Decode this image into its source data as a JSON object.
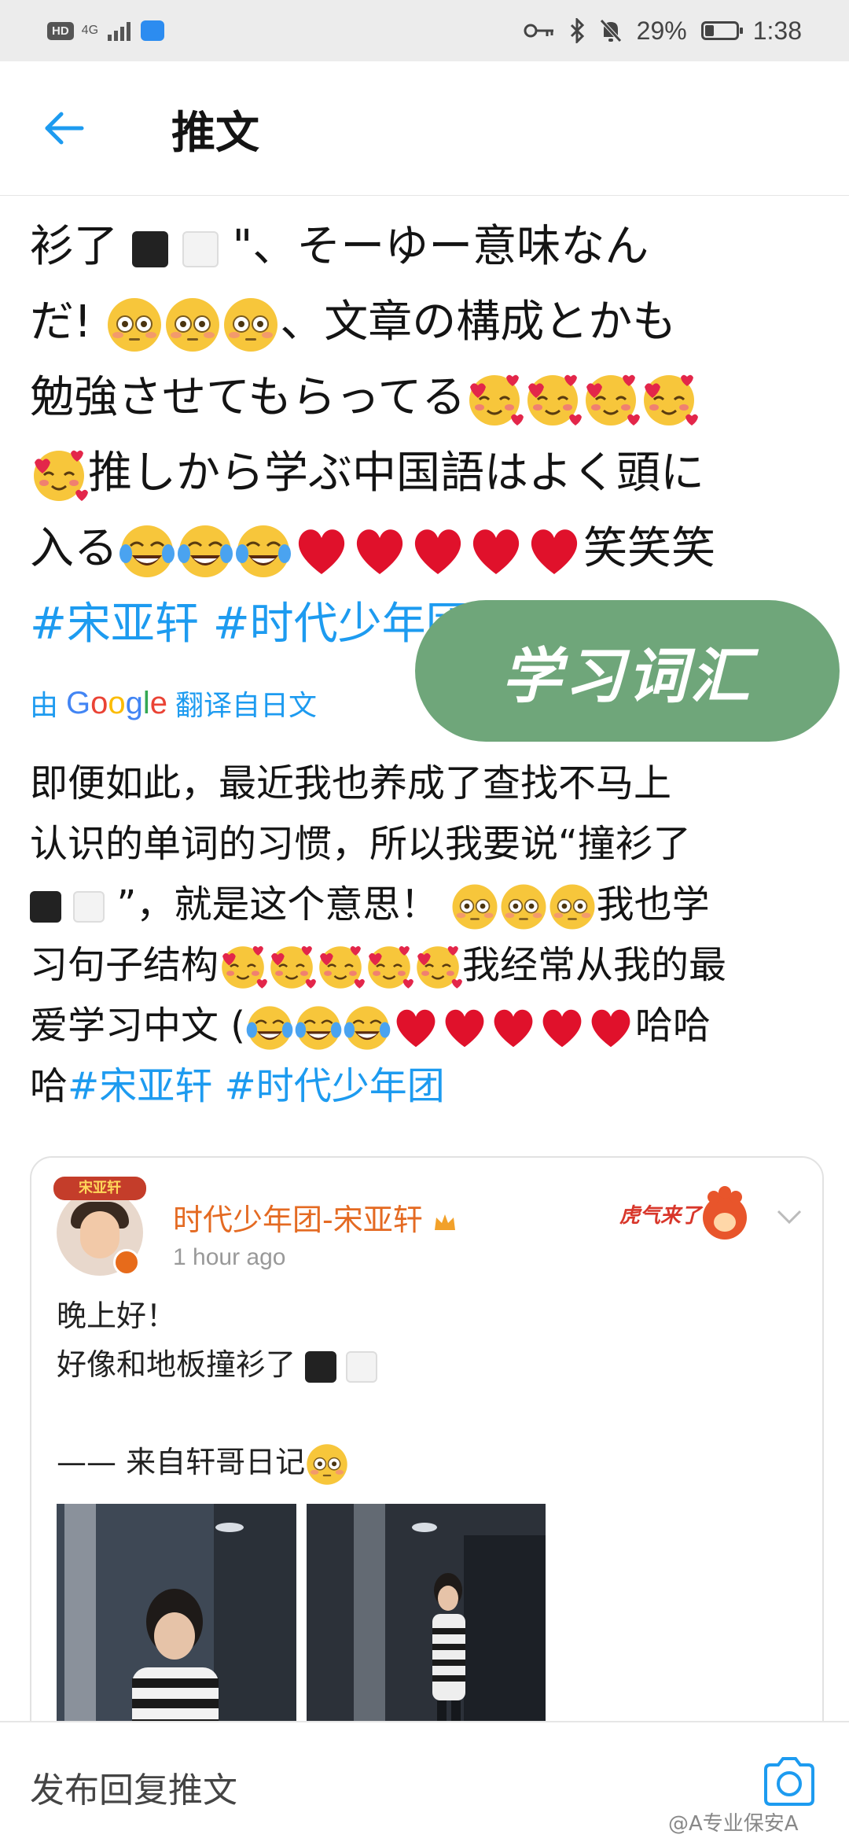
{
  "status_bar": {
    "hd": "HD",
    "network": "4G",
    "battery_percent": "29%",
    "battery_level": 0.29,
    "time": "1:38",
    "icons": [
      "key-icon",
      "bluetooth-icon",
      "mute-bell-icon",
      "cloud-app-icon"
    ]
  },
  "app_bar": {
    "back_icon": "arrow-left-icon",
    "title": "推文"
  },
  "tweet": {
    "lines": [
      "衫了",
      "\"、そーゆー意味なん",
      "だ!",
      "、文章の構成とかも",
      "勉強させてもらってる",
      "推しから学ぶ中国語はよく頭に",
      "入る",
      "笑笑笑"
    ],
    "hashtags": "#宋亚轩 #时代少年团"
  },
  "overlay_label": "学习词汇",
  "translation": {
    "by": "由",
    "google": "Google",
    "translated_from": "翻译自日文",
    "lines": [
      "即便如此，最近我也养成了查找不马上",
      "认识的单词的习惯，所以我要说“撞衫了",
      "”，就是这个意思！",
      "我也学",
      "习句子结构",
      "我经常从我的最",
      "爱学习中文 (",
      "哈哈",
      "哈"
    ],
    "hashtags": "#宋亚轩 #时代少年团"
  },
  "embedded_post": {
    "author": "时代少年团-宋亚轩",
    "time": "1 hour ago",
    "line1": "晚上好！",
    "line2": "好像和地板撞衫了",
    "line3": "—— 来自轩哥日记",
    "avatar_banner": "宋亚轩",
    "sticker_text": "虎气来了"
  },
  "reply_bar": {
    "placeholder": "发布回复推文",
    "camera_icon": "camera-icon"
  },
  "watermark": "@A专业保安A"
}
